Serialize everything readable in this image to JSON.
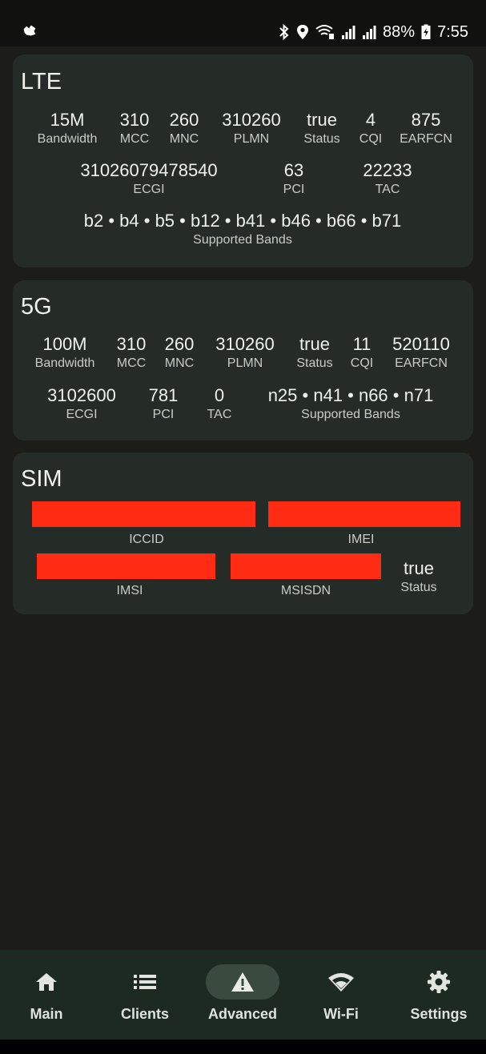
{
  "status_bar": {
    "battery": "88%",
    "time": "7:55",
    "icons": [
      "app-icon",
      "bluetooth-icon",
      "location-icon",
      "wifi-calling-icon",
      "signal-icon",
      "signal-icon",
      "battery-charging-icon"
    ]
  },
  "lte": {
    "title": "LTE",
    "row1": [
      {
        "value": "15M",
        "label": "Bandwidth"
      },
      {
        "value": "310",
        "label": "MCC"
      },
      {
        "value": "260",
        "label": "MNC"
      },
      {
        "value": "310260",
        "label": "PLMN"
      },
      {
        "value": "true",
        "label": "Status"
      },
      {
        "value": "4",
        "label": "CQI"
      },
      {
        "value": "875",
        "label": "EARFCN"
      }
    ],
    "row2": [
      {
        "value": "31026079478540",
        "label": "ECGI"
      },
      {
        "value": "63",
        "label": "PCI"
      },
      {
        "value": "22233",
        "label": "TAC"
      }
    ],
    "bands": {
      "value": "b2 • b4 • b5 • b12 • b41 • b46 • b66 • b71",
      "label": "Supported Bands"
    }
  },
  "nr5g": {
    "title": "5G",
    "row1": [
      {
        "value": "100M",
        "label": "Bandwidth"
      },
      {
        "value": "310",
        "label": "MCC"
      },
      {
        "value": "260",
        "label": "MNC"
      },
      {
        "value": "310260",
        "label": "PLMN"
      },
      {
        "value": "true",
        "label": "Status"
      },
      {
        "value": "11",
        "label": "CQI"
      },
      {
        "value": "520110",
        "label": "EARFCN"
      }
    ],
    "row2": [
      {
        "value": "3102600",
        "label": "ECGI"
      },
      {
        "value": "781",
        "label": "PCI"
      },
      {
        "value": "0",
        "label": "TAC"
      },
      {
        "value": "n25 • n41 • n66 • n71",
        "label": "Supported Bands"
      }
    ]
  },
  "sim": {
    "title": "SIM",
    "iccid_label": "ICCID",
    "imei_label": "IMEI",
    "imsi_label": "IMSI",
    "msisdn_label": "MSISDN",
    "status": {
      "value": "true",
      "label": "Status"
    },
    "redaction_color": "#ff2b12"
  },
  "nav": {
    "items": [
      {
        "label": "Main",
        "icon": "home-icon"
      },
      {
        "label": "Clients",
        "icon": "list-icon"
      },
      {
        "label": "Advanced",
        "icon": "warning-icon",
        "active": true
      },
      {
        "label": "Wi-Fi",
        "icon": "wifi-icon"
      },
      {
        "label": "Settings",
        "icon": "gear-icon"
      }
    ]
  },
  "colors": {
    "background": "#1c1d18",
    "card": "#252c27",
    "nav_background": "#1d2a22",
    "active_pill": "#3b4a3f"
  }
}
